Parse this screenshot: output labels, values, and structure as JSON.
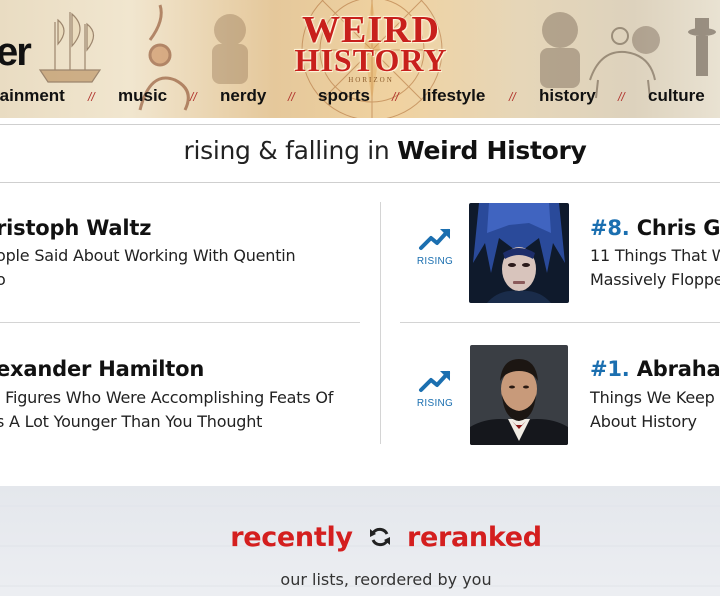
{
  "header": {
    "site_name_fragment": "er",
    "logo": {
      "line1": "WEIRD",
      "line2": "HISTORY",
      "sub": "HORIZON"
    }
  },
  "nav": {
    "items": [
      {
        "label": "tainment"
      },
      {
        "label": "music"
      },
      {
        "label": "nerdy"
      },
      {
        "label": "sports"
      },
      {
        "label": "lifestyle"
      },
      {
        "label": "history"
      },
      {
        "label": "culture"
      }
    ],
    "separator": "//"
  },
  "section": {
    "title_prefix": "rising & falling in",
    "title_strong": "Weird History"
  },
  "cards": {
    "left": [
      {
        "title": "ristoph Waltz",
        "sub1": "ople Said About Working With Quentin",
        "sub2": "o"
      },
      {
        "title": "exander Hamilton",
        "sub1": "l Figures Who Were Accomplishing Feats Of",
        "sub2": "s A Lot Younger Than You Thought"
      }
    ],
    "right": [
      {
        "trend": "RISING",
        "rank": "#8.",
        "title": "Chris Ga",
        "sub1": "11 Things That W",
        "sub2": "Massively Floppe"
      },
      {
        "trend": "RISING",
        "rank": "#1.",
        "title": "Abrahar",
        "sub1": "Things We Keep",
        "sub2": "About History"
      }
    ]
  },
  "reranked": {
    "word1": "recently",
    "word2": "reranked",
    "subtitle": "our lists, reordered by you"
  },
  "colors": {
    "accent_red": "#d41f1f",
    "accent_blue": "#1b6fb0",
    "logo_red": "#c8201c"
  },
  "icons": [
    "trend-up-icon",
    "refresh-cycle-icon"
  ]
}
